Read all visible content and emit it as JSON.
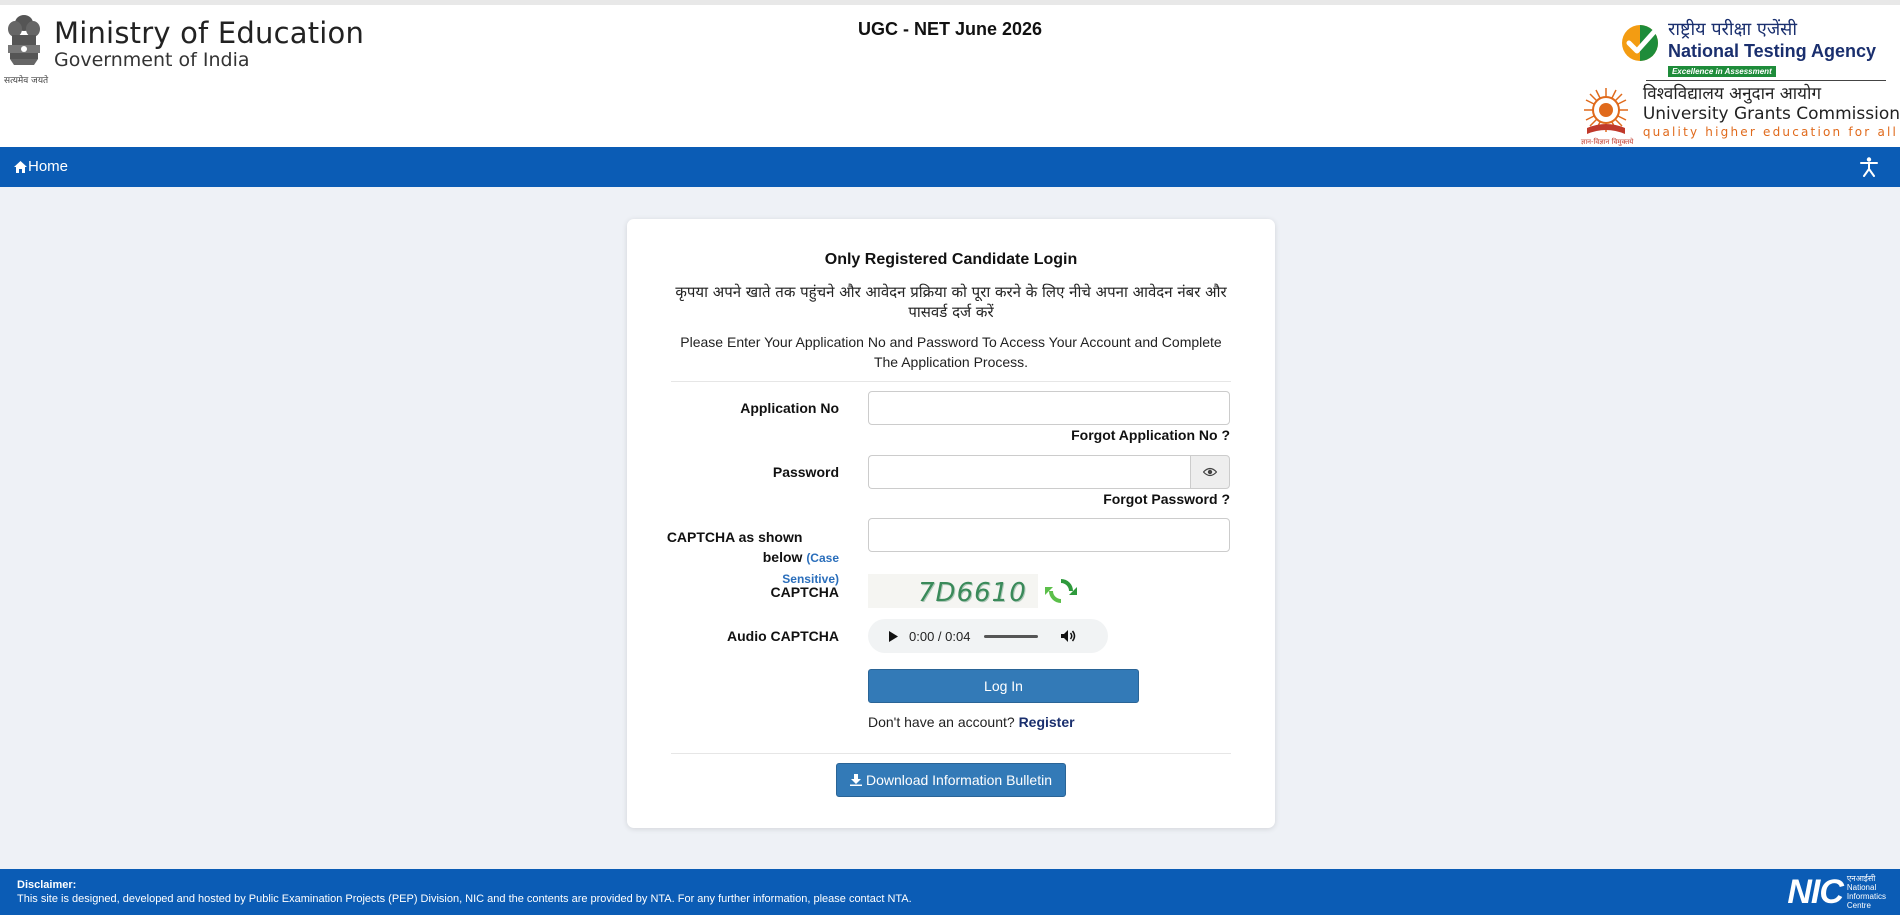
{
  "header": {
    "ministry_title": "Ministry of Education",
    "ministry_subtitle": "Government of India",
    "emblem_caption": "सत्यमेव जयते",
    "exam_title": "UGC - NET June 2026",
    "nta_hindi": "राष्ट्रीय परीक्षा एजेंसी",
    "nta_english": "National Testing Agency",
    "nta_tagline": "Excellence in Assessment",
    "ugc_hindi": "विश्वविद्यालय अनुदान आयोग",
    "ugc_english": "University Grants Commission",
    "ugc_tagline": "quality higher education for all",
    "ugc_caption": "ज्ञान-विज्ञान विमुक्तये"
  },
  "nav": {
    "home_label": "Home"
  },
  "login": {
    "title": "Only Registered Candidate Login",
    "hindi_instruction": "कृपया अपने खाते तक पहुंचने और आवेदन प्रक्रिया को पूरा करने के लिए नीचे अपना आवेदन नंबर और पासवर्ड दर्ज करें",
    "english_instruction": "Please Enter Your Application No and Password To Access Your Account and Complete The Application Process.",
    "application_no_label": "Application No",
    "application_no_value": "",
    "forgot_application_link": "Forgot Application No ?",
    "password_label": "Password",
    "password_value": "",
    "forgot_password_link": "Forgot Password ?",
    "captcha_input_label_main": "CAPTCHA as shown below",
    "captcha_input_label_note": "(Case Sensitive)",
    "captcha_input_value": "",
    "captcha_label": "CAPTCHA",
    "captcha_text": "7D6610",
    "audio_captcha_label": "Audio CAPTCHA",
    "audio_time": "0:00 / 0:04",
    "login_button": "Log In",
    "no_account_text": "Don't have an account?",
    "register_link": "Register",
    "download_button": "Download Information Bulletin"
  },
  "footer": {
    "disclaimer_title": "Disclaimer:",
    "disclaimer_text": "This site is designed, developed and hosted by Public Examination Projects (PEP) Division, NIC and the contents are provided by NTA. For any further information, please contact NTA.",
    "nic_logo_text": "NIC",
    "nic_hindi": "एनआईसी",
    "nic_line1": "National",
    "nic_line2": "Informatics",
    "nic_line3": "Centre"
  },
  "colors": {
    "nav_blue": "#0b5cb5",
    "button_blue": "#337ab7",
    "page_background": "#eef1f6",
    "nta_green": "#1e8c3a",
    "ugc_orange": "#e06a1c"
  }
}
